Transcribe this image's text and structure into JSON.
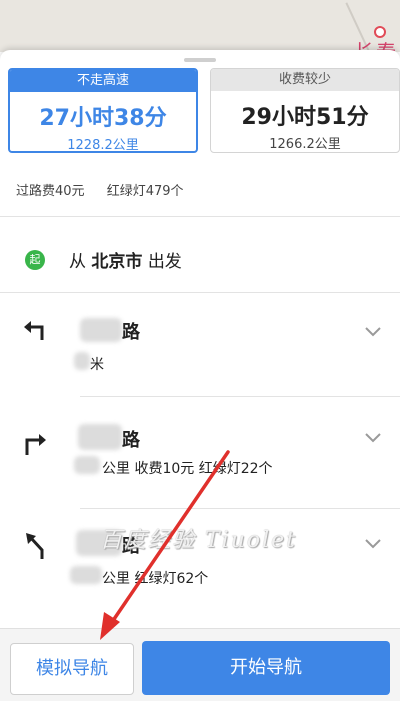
{
  "map": {
    "city_label": "长春"
  },
  "routes": [
    {
      "tag": "不走高速",
      "duration": "27小时38分",
      "distance": "1228.2公里",
      "selected": true
    },
    {
      "tag": "收费较少",
      "duration": "29小时51分",
      "distance": "1266.2公里",
      "selected": false
    }
  ],
  "summary": {
    "toll": "过路费40元",
    "lights": "红绿灯479个"
  },
  "start": {
    "badge": "起",
    "prefix": "从",
    "city": "北京市",
    "suffix": "出发"
  },
  "steps": [
    {
      "icon": "turn-left-icon",
      "road_suffix": "路",
      "detail": "米"
    },
    {
      "icon": "turn-right-icon",
      "road_suffix": "路",
      "detail": "公里  收费10元  红绿灯22个"
    },
    {
      "icon": "bear-left-icon",
      "road_suffix": "路",
      "detail": "公里  红绿灯62个"
    }
  ],
  "buttons": {
    "simulate": "模拟导航",
    "start": "开始导航"
  },
  "watermark": "百度经验 Tiuolet",
  "colors": {
    "accent": "#3e86e6",
    "start_badge": "#39b54a",
    "arrow": "#e0302c"
  }
}
